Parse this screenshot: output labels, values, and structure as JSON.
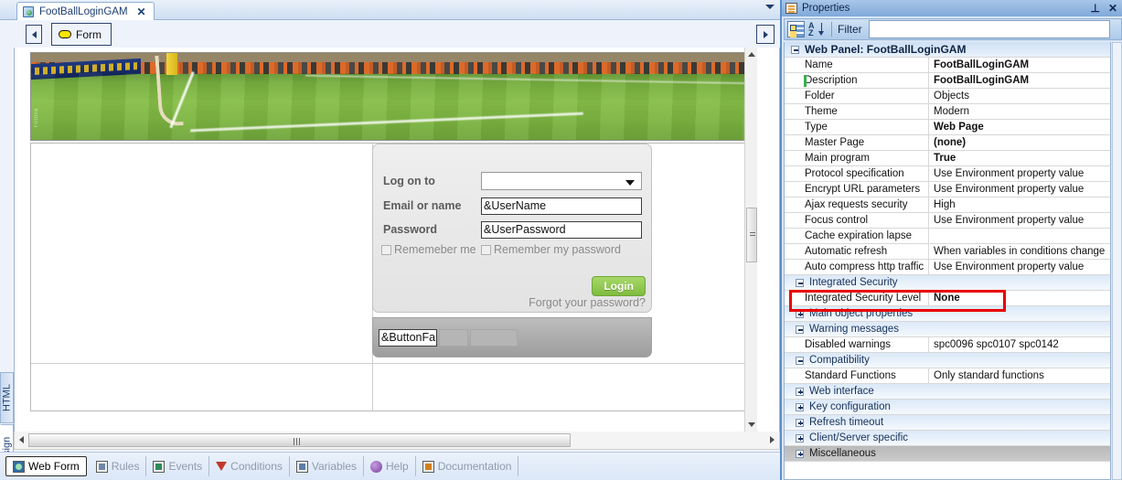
{
  "window": {
    "document_tab": {
      "label": "FootBallLoginGAM",
      "close": "✕",
      "icon": "webpanel-icon"
    },
    "tabstrip_more_icon": "chevron-down-icon"
  },
  "designer": {
    "toolbar": {
      "collapse_icon": "left-arrow-icon",
      "form_button": "Form",
      "form_icon": "oval-yellow-icon",
      "scroll_right_icon": "right-arrow-icon"
    },
    "side_tabs": [
      {
        "label": "HTML",
        "active": false
      },
      {
        "label": "Design",
        "active": true
      }
    ],
    "banner": {
      "alt": "football-stadium-pitch-photo",
      "watermark": "Fotolia"
    },
    "login_form": {
      "logon_to_label": "Log on to",
      "logon_to_value": "",
      "email_label": "Email or name",
      "email_value": "&UserName",
      "password_label": "Password",
      "password_value": "&UserPassword",
      "remember_me_label": "Rememeber me",
      "remember_password_label": "Remember my password",
      "login_button": "Login",
      "forgot_link": "Forgot your password?",
      "button_variable": "&ButtonFa"
    }
  },
  "bottom_tabs": [
    {
      "label": "Web Form",
      "icon": "webform-icon",
      "active": true
    },
    {
      "label": "Rules",
      "icon": "rules-icon",
      "active": false
    },
    {
      "label": "Events",
      "icon": "events-icon",
      "active": false
    },
    {
      "label": "Conditions",
      "icon": "funnel-icon",
      "active": false
    },
    {
      "label": "Variables",
      "icon": "variables-icon",
      "active": false
    },
    {
      "label": "Help",
      "icon": "help-icon",
      "active": false
    },
    {
      "label": "Documentation",
      "icon": "documentation-icon",
      "active": false
    }
  ],
  "properties": {
    "title": "Properties",
    "title_icon": "properties-icon",
    "pin_icon": "pin-icon",
    "close_icon": "close-icon",
    "toolbar": {
      "categorized_icon": "categorized-view-icon",
      "sort_icon": "alphabetical-sort-icon",
      "sort_label_a": "A",
      "sort_label_z": "Z",
      "filter_label": "Filter",
      "filter_value": ""
    },
    "header_row": {
      "label": "Web Panel: FootBallLoginGAM",
      "expanded": true
    },
    "rows": [
      {
        "kind": "prop",
        "name": "Name",
        "value": "FootBallLoginGAM",
        "bold": true,
        "modified": false
      },
      {
        "kind": "prop",
        "name": "Description",
        "value": "FootBallLoginGAM",
        "bold": true,
        "modified": true
      },
      {
        "kind": "prop",
        "name": "Folder",
        "value": "Objects",
        "bold": false,
        "modified": false
      },
      {
        "kind": "prop",
        "name": "Theme",
        "value": "Modern",
        "bold": false,
        "modified": false
      },
      {
        "kind": "prop",
        "name": "Type",
        "value": "Web Page",
        "bold": true,
        "modified": false
      },
      {
        "kind": "prop",
        "name": "Master Page",
        "value": "(none)",
        "bold": true,
        "modified": false
      },
      {
        "kind": "prop",
        "name": "Main program",
        "value": "True",
        "bold": true,
        "modified": false
      },
      {
        "kind": "prop",
        "name": "Protocol specification",
        "value": "Use Environment property value",
        "bold": false,
        "modified": false
      },
      {
        "kind": "prop",
        "name": "Encrypt URL parameters",
        "value": "Use Environment property value",
        "bold": false,
        "modified": false
      },
      {
        "kind": "prop",
        "name": "Ajax requests security",
        "value": "High",
        "bold": false,
        "modified": false
      },
      {
        "kind": "prop",
        "name": "Focus control",
        "value": "Use Environment property value",
        "bold": false,
        "modified": false
      },
      {
        "kind": "prop",
        "name": "Cache expiration lapse",
        "value": "",
        "bold": false,
        "modified": false
      },
      {
        "kind": "prop",
        "name": "Automatic refresh",
        "value": "When variables in conditions change",
        "bold": false,
        "modified": false
      },
      {
        "kind": "prop",
        "name": "Auto compress http traffic",
        "value": "Use Environment property value",
        "bold": false,
        "modified": false
      },
      {
        "kind": "cat",
        "name": "Integrated Security",
        "expanded": true,
        "grey": false
      },
      {
        "kind": "prop",
        "name": "Integrated Security Level",
        "value": "None",
        "bold": true,
        "modified": false,
        "highlighted": true
      },
      {
        "kind": "cat",
        "name": "Main object properties",
        "expanded": false,
        "grey": false
      },
      {
        "kind": "cat",
        "name": "Warning messages",
        "expanded": true,
        "grey": false
      },
      {
        "kind": "prop",
        "name": "Disabled warnings",
        "value": "spc0096 spc0107 spc0142",
        "bold": false,
        "modified": false
      },
      {
        "kind": "cat",
        "name": "Compatibility",
        "expanded": true,
        "grey": false
      },
      {
        "kind": "prop",
        "name": "Standard Functions",
        "value": "Only standard functions",
        "bold": false,
        "modified": false
      },
      {
        "kind": "cat",
        "name": "Web interface",
        "expanded": false,
        "grey": false
      },
      {
        "kind": "cat",
        "name": "Key configuration",
        "expanded": false,
        "grey": false
      },
      {
        "kind": "cat",
        "name": "Refresh timeout",
        "expanded": false,
        "grey": false
      },
      {
        "kind": "cat",
        "name": "Client/Server specific",
        "expanded": false,
        "grey": false
      },
      {
        "kind": "cat",
        "name": "Miscellaneous",
        "expanded": false,
        "grey": true
      }
    ]
  },
  "colors": {
    "highlight_red": "#e90000",
    "login_green": "#7fbc3f",
    "accent_blue": "#5b8fcb"
  }
}
